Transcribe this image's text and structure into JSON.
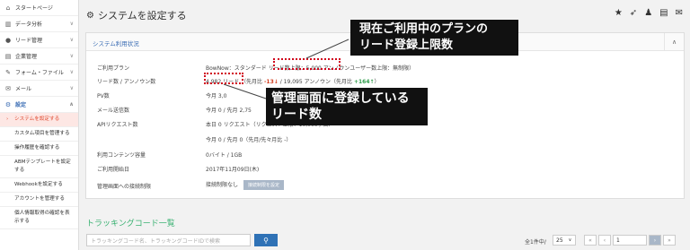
{
  "sidebar": {
    "items": [
      {
        "label": "スタートページ",
        "icon": "home-icon",
        "chevron": ""
      },
      {
        "label": "データ分析",
        "icon": "chart-icon",
        "chevron": "∨"
      },
      {
        "label": "リード管理",
        "icon": "user-icon",
        "chevron": "∨"
      },
      {
        "label": "企業管理",
        "icon": "building-icon",
        "chevron": "∨"
      },
      {
        "label": "フォーム・ファイル",
        "icon": "edit-icon",
        "chevron": "∨"
      },
      {
        "label": "メール",
        "icon": "mail-icon",
        "chevron": "∨"
      },
      {
        "label": "設定",
        "icon": "gear-icon",
        "chevron": "∧"
      }
    ],
    "sub_items": [
      "システムを設定する",
      "カスタム項目を管理する",
      "操作履歴を確認する",
      "ABMテンプレートを設定する",
      "Webhookを設定する",
      "アカウントを管理する",
      "個人情報取得の確認を表示する"
    ]
  },
  "header": {
    "title": "システムを設定する",
    "icons": [
      "star-icon",
      "rocket-icon",
      "person-icon",
      "document-icon",
      "mail-icon"
    ]
  },
  "panel": {
    "title": "システム利用状況",
    "collapse_icon": "∧",
    "rows": [
      {
        "label": "ご利用プラン",
        "value": "BowNow：スタンダード リード数上限：5,000 アンノウンユーザー数上限：無制限）"
      },
      {
        "label": "リード数 / アンノウン数",
        "lead": "4,982 リード",
        "prev_label": "（先月比 ",
        "lead_diff": "-13↓",
        "unknown": "/  19,095 アンノウン（先月比 ",
        "unknown_diff": "+164↑",
        "close": "）"
      },
      {
        "label": "PV数",
        "value": "今月 3,0"
      },
      {
        "label": "メール送信数",
        "value": "今月 0  /  先月 2,75"
      },
      {
        "label": "APIリクエスト数",
        "value": "本日 0 リクエスト（リクエスト上限：10,000 / 日）"
      },
      {
        "label": "",
        "value": "今月 0  /  先月 0（先月/先々月比 -）"
      },
      {
        "label": "利用コンテンツ容量",
        "value": "0バイト  /  1GB"
      },
      {
        "label": "ご利用開始日",
        "value": "2017年11月09日(木)"
      },
      {
        "label": "管理画面への接続制限",
        "value": "接続制限なし",
        "button": "接続制限を設定"
      }
    ]
  },
  "callouts": {
    "top": [
      "現在ご利用中のプランの",
      "リード登録上限数"
    ],
    "bottom": [
      "管理画面に登録している",
      "リード数"
    ]
  },
  "tracking": {
    "title": "トラッキングコード一覧",
    "search_placeholder": "トラッキングコード名、トラッキングコードIDで検索",
    "count_text": "全1件中/",
    "per_page": "25",
    "page": "1",
    "pager": [
      "«",
      "‹",
      "›",
      "»"
    ]
  }
}
